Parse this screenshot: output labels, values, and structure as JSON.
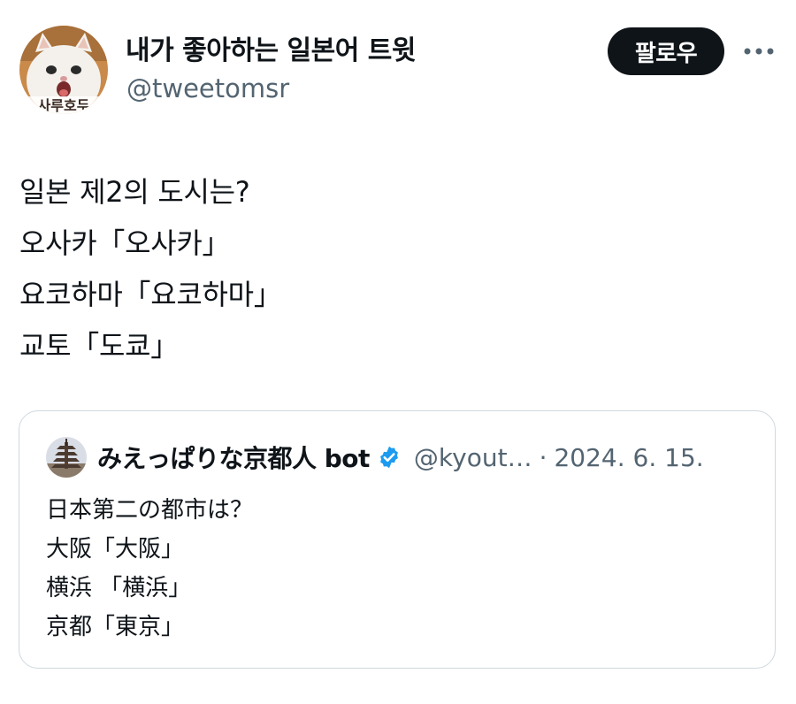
{
  "author": {
    "display_name": "내가 좋아하는 일본어 트윗",
    "handle": "@tweetomsr",
    "avatar_icon": "white-cat-avatar",
    "avatar_caption": "사루호두"
  },
  "actions": {
    "follow_label": "팔로우",
    "more_icon": "more-dots-icon"
  },
  "tweet": {
    "lines": [
      "일본 제2의 도시는?",
      "오사카「오사카」",
      "요코하마「요코하마」",
      "교토「도쿄」"
    ]
  },
  "quoted_tweet": {
    "author_name": "みえっぱりな京都人 bot",
    "verified_icon": "verified-badge-icon",
    "handle": "@kyout…",
    "separator": "·",
    "date": "2024. 6. 15.",
    "avatar_icon": "pagoda-avatar",
    "lines": [
      "日本第二の都市は？",
      "大阪「大阪」",
      "横浜 「横浜」",
      "京都「東京」"
    ]
  },
  "colors": {
    "text_primary": "#0f1419",
    "text_secondary": "#536471",
    "border": "#cfd9de",
    "verified_blue": "#1d9bf0",
    "follow_bg": "#0f1419"
  }
}
